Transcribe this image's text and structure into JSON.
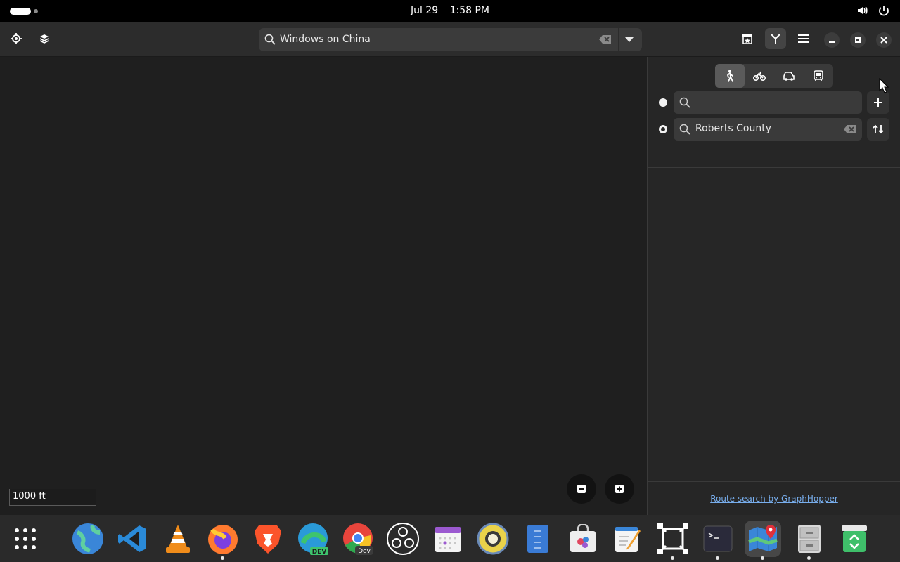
{
  "topbar": {
    "date": "Jul 29",
    "time": "1:58 PM",
    "tray_icons": [
      "volume-icon",
      "power-icon"
    ]
  },
  "headerbar": {
    "left_buttons": [
      "locate-icon",
      "layers-icon"
    ],
    "search": {
      "value": "Windows on China",
      "placeholder": ""
    },
    "right_buttons": [
      "favorites-icon",
      "route-icon",
      "menu-icon"
    ],
    "window_controls": [
      "minimize-icon",
      "maximize-icon",
      "close-icon"
    ]
  },
  "map": {
    "scale_label": "1000 ft",
    "zoom_out_icon": "zoom-out-icon",
    "zoom_in_icon": "zoom-in-icon"
  },
  "sidebar": {
    "transport_modes": [
      {
        "name": "walk",
        "icon": "pedestrian-icon",
        "active": true
      },
      {
        "name": "bike",
        "icon": "bicycle-icon",
        "active": false
      },
      {
        "name": "car",
        "icon": "car-icon",
        "active": false
      },
      {
        "name": "transit",
        "icon": "bus-icon",
        "active": false
      }
    ],
    "route_points": [
      {
        "value": "",
        "placeholder": "",
        "action": "add-icon"
      },
      {
        "value": "Roberts County",
        "placeholder": "",
        "action": "swap-icon"
      }
    ],
    "credit_link": "Route search by GraphHopper"
  },
  "dock": {
    "items": [
      {
        "name": "app-grid",
        "running": false
      },
      {
        "name": "web-browser",
        "running": false
      },
      {
        "name": "vscode",
        "running": false
      },
      {
        "name": "vlc",
        "running": false
      },
      {
        "name": "firefox",
        "running": true
      },
      {
        "name": "brave",
        "running": false
      },
      {
        "name": "edge-dev",
        "running": false
      },
      {
        "name": "chrome-dev",
        "running": false
      },
      {
        "name": "obs",
        "running": false
      },
      {
        "name": "calendar",
        "running": false
      },
      {
        "name": "rhythmbox",
        "running": false
      },
      {
        "name": "text-file",
        "running": false
      },
      {
        "name": "software-store",
        "running": false
      },
      {
        "name": "text-editor",
        "running": false
      },
      {
        "name": "screenshot-tool",
        "running": true
      },
      {
        "name": "terminal",
        "running": true
      },
      {
        "name": "maps",
        "running": true,
        "focused": true
      },
      {
        "name": "file-cabinet",
        "running": true
      },
      {
        "name": "trash",
        "running": false
      }
    ],
    "edge_dev_badge": "DEV",
    "chrome_dev_badge": "Dev"
  },
  "colors": {
    "accent_link": "#78aeed",
    "panel_bg": "#262626",
    "map_bg": "#1f1f1f"
  }
}
